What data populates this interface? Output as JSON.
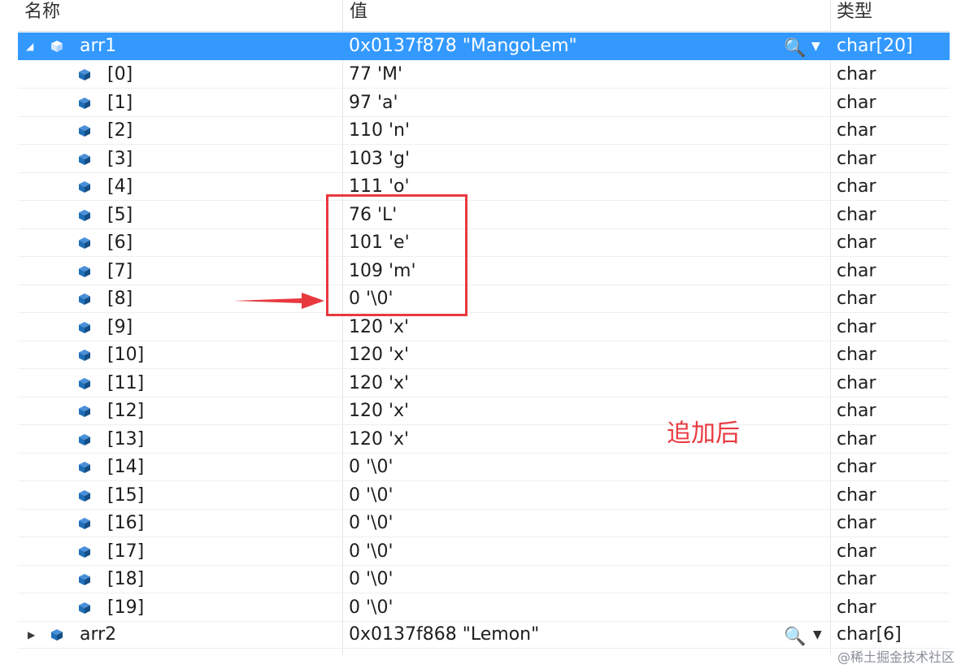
{
  "columns": {
    "name": "名称",
    "value": "值",
    "type": "类型"
  },
  "arr1": {
    "name": "arr1",
    "value": "0x0137f878 \"MangoLem\"",
    "type": "char[20]",
    "items": [
      {
        "index": "[0]",
        "value": "77 'M'",
        "type": "char"
      },
      {
        "index": "[1]",
        "value": "97 'a'",
        "type": "char"
      },
      {
        "index": "[2]",
        "value": "110 'n'",
        "type": "char"
      },
      {
        "index": "[3]",
        "value": "103 'g'",
        "type": "char"
      },
      {
        "index": "[4]",
        "value": "111 'o'",
        "type": "char"
      },
      {
        "index": "[5]",
        "value": "76 'L'",
        "type": "char"
      },
      {
        "index": "[6]",
        "value": "101 'e'",
        "type": "char"
      },
      {
        "index": "[7]",
        "value": "109 'm'",
        "type": "char"
      },
      {
        "index": "[8]",
        "value": "0 '\\0'",
        "type": "char"
      },
      {
        "index": "[9]",
        "value": "120 'x'",
        "type": "char"
      },
      {
        "index": "[10]",
        "value": "120 'x'",
        "type": "char"
      },
      {
        "index": "[11]",
        "value": "120 'x'",
        "type": "char"
      },
      {
        "index": "[12]",
        "value": "120 'x'",
        "type": "char"
      },
      {
        "index": "[13]",
        "value": "120 'x'",
        "type": "char"
      },
      {
        "index": "[14]",
        "value": "0 '\\0'",
        "type": "char"
      },
      {
        "index": "[15]",
        "value": "0 '\\0'",
        "type": "char"
      },
      {
        "index": "[16]",
        "value": "0 '\\0'",
        "type": "char"
      },
      {
        "index": "[17]",
        "value": "0 '\\0'",
        "type": "char"
      },
      {
        "index": "[18]",
        "value": "0 '\\0'",
        "type": "char"
      },
      {
        "index": "[19]",
        "value": "0 '\\0'",
        "type": "char"
      }
    ]
  },
  "arr2": {
    "name": "arr2",
    "value": "0x0137f868 \"Lemon\"",
    "type": "char[6]"
  },
  "annotation": {
    "note": "追加后",
    "color": "#e8393f"
  },
  "watermark": "@稀土掘金技术社区",
  "colors": {
    "selection": "#3399ff",
    "cube": "#1f6fb8"
  },
  "icons": [
    "expanded-triangle-icon",
    "collapsed-triangle-icon",
    "variable-cube-icon",
    "magnifier-icon",
    "dropdown-arrow-icon",
    "red-arrow-icon"
  ]
}
